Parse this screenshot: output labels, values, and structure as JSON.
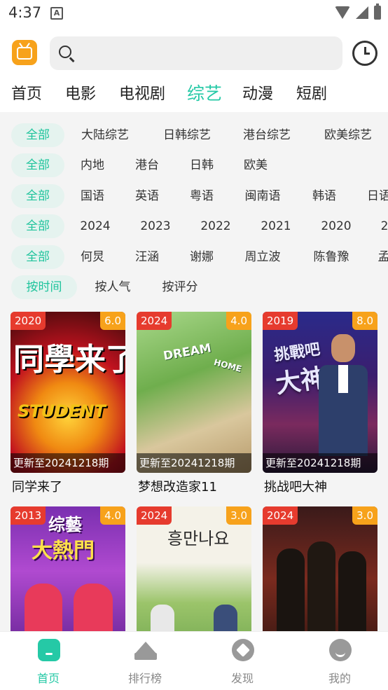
{
  "status": {
    "time": "4:37",
    "notif": "A"
  },
  "tabs": [
    {
      "label": "首页"
    },
    {
      "label": "电影"
    },
    {
      "label": "电视剧"
    },
    {
      "label": "综艺",
      "active": true
    },
    {
      "label": "动漫"
    },
    {
      "label": "短剧"
    }
  ],
  "filters": {
    "genre": [
      "全部",
      "大陆综艺",
      "日韩综艺",
      "港台综艺",
      "欧美综艺"
    ],
    "region": [
      "全部",
      "内地",
      "港台",
      "日韩",
      "欧美"
    ],
    "language": [
      "全部",
      "国语",
      "英语",
      "粤语",
      "闽南语",
      "韩语",
      "日语"
    ],
    "year": [
      "全部",
      "2024",
      "2023",
      "2022",
      "2021",
      "2020",
      "2"
    ],
    "person": [
      "全部",
      "何炅",
      "汪涵",
      "谢娜",
      "周立波",
      "陈鲁豫",
      "孟"
    ],
    "sort": [
      "按时间",
      "按人气",
      "按评分"
    ]
  },
  "cards": [
    {
      "year": "2020",
      "score": "6.0",
      "update": "更新至20241218期",
      "title": "同学来了",
      "poster_text": "同學来了",
      "poster_sub": "STUDENT"
    },
    {
      "year": "2024",
      "score": "4.0",
      "update": "更新至20241218期",
      "title": "梦想改造家11",
      "poster_text": "DREAM",
      "poster_sub": "HOME"
    },
    {
      "year": "2019",
      "score": "8.0",
      "update": "更新至20241218期",
      "title": "挑战吧大神",
      "poster_text": "挑戰吧",
      "poster_sub": "大神"
    },
    {
      "year": "2013",
      "score": "4.0",
      "update": "",
      "title": "",
      "poster_text": "综藝",
      "poster_sub": "大熱門"
    },
    {
      "year": "2024",
      "score": "3.0",
      "update": "",
      "title": "",
      "poster_text": "흥만나요",
      "poster_sub": ""
    },
    {
      "year": "2024",
      "score": "3.0",
      "update": "",
      "title": "",
      "poster_text": "",
      "poster_sub": ""
    }
  ],
  "nav": [
    {
      "label": "首页",
      "icon": "home-icon",
      "active": true
    },
    {
      "label": "排行榜",
      "icon": "crown-icon"
    },
    {
      "label": "发现",
      "icon": "discover-icon"
    },
    {
      "label": "我的",
      "icon": "profile-icon"
    }
  ],
  "colors": {
    "accent": "#25c9a6",
    "year_badge": "#e63b2e",
    "score_badge": "#f7a21b"
  }
}
